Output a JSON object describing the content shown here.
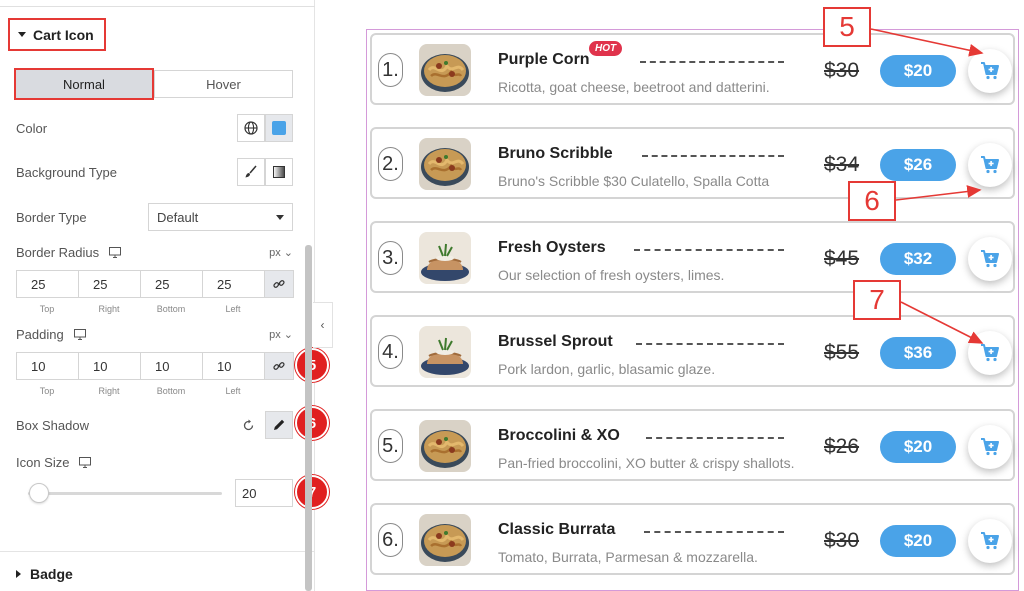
{
  "panel": {
    "section_title": "Cart Icon",
    "tabs": [
      {
        "label": "Normal",
        "active": true
      },
      {
        "label": "Hover",
        "active": false
      }
    ],
    "color": {
      "label": "Color",
      "swatch": "#4aa3e8"
    },
    "background_type": {
      "label": "Background Type"
    },
    "border_type": {
      "label": "Border Type",
      "value": "Default"
    },
    "border_radius": {
      "label": "Border Radius",
      "unit": "px",
      "values": [
        "25",
        "25",
        "25",
        "25"
      ],
      "captions": [
        "Top",
        "Right",
        "Bottom",
        "Left"
      ]
    },
    "padding": {
      "label": "Padding",
      "unit": "px",
      "values": [
        "10",
        "10",
        "10",
        "10"
      ],
      "captions": [
        "Top",
        "Right",
        "Bottom",
        "Left"
      ]
    },
    "box_shadow": {
      "label": "Box Shadow"
    },
    "icon_size": {
      "label": "Icon Size",
      "value": "20",
      "slider_fraction": 0.06
    },
    "badge_section": "Badge",
    "badges": [
      "5",
      "6",
      "7"
    ]
  },
  "menu": {
    "items": [
      {
        "index": "1.",
        "title": "Purple Corn",
        "hot": "HOT",
        "desc": "Ricotta, goat cheese, beetroot and datterini.",
        "old_price": "$30",
        "new_price": "$20",
        "thumb": "pasta"
      },
      {
        "index": "2.",
        "title": "Bruno Scribble",
        "hot": "",
        "desc": "Bruno's Scribble $30 Culatello, Spalla Cotta",
        "old_price": "$34",
        "new_price": "$26",
        "thumb": "pasta"
      },
      {
        "index": "3.",
        "title": "Fresh Oysters",
        "hot": "",
        "desc": "Our selection of fresh oysters, limes.",
        "old_price": "$45",
        "new_price": "$32",
        "thumb": "cake"
      },
      {
        "index": "4.",
        "title": "Brussel Sprout",
        "hot": "",
        "desc": "Pork lardon, garlic, blasamic glaze.",
        "old_price": "$55",
        "new_price": "$36",
        "thumb": "cake"
      },
      {
        "index": "5.",
        "title": "Broccolini & XO",
        "hot": "",
        "desc": "Pan-fried broccolini, XO butter & crispy shallots.",
        "old_price": "$26",
        "new_price": "$20",
        "thumb": "pasta"
      },
      {
        "index": "6.",
        "title": "Classic Burrata",
        "hot": "",
        "desc": "Tomato, Burrata, Parmesan & mozzarella.",
        "old_price": "$30",
        "new_price": "$20",
        "thumb": "pasta"
      }
    ],
    "accent_color": "#4aa3e8",
    "hot_color": "#e0334c"
  },
  "callouts": [
    "5",
    "6",
    "7"
  ],
  "icons": [
    "caret-down-icon",
    "globe-icon",
    "brush-icon",
    "gradient-icon",
    "monitor-icon",
    "link-icon",
    "reset-icon",
    "pencil-icon",
    "chevron-left-icon",
    "cart-icon"
  ]
}
